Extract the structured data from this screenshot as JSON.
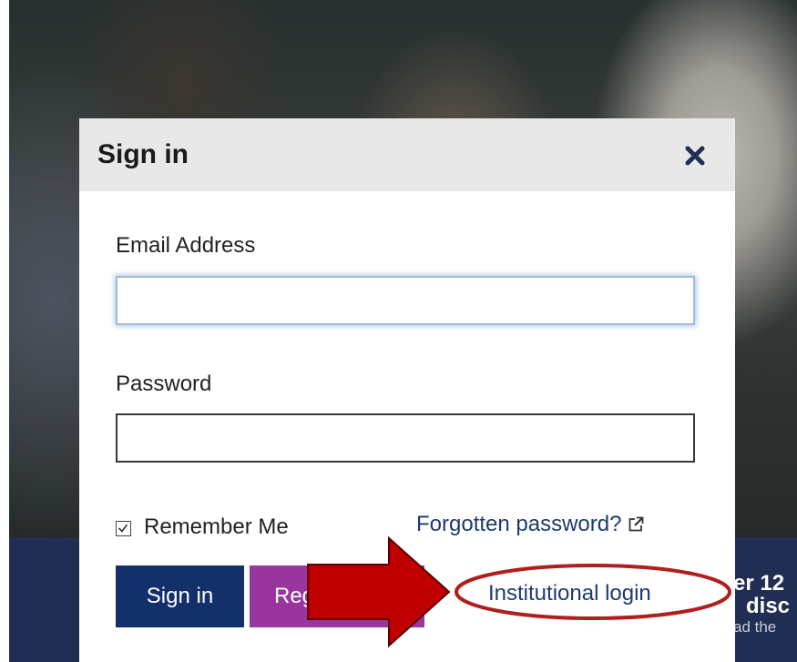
{
  "background": {
    "teaser_line1": "er 12",
    "teaser_line2": "disc",
    "teaser_line3": "ad the"
  },
  "modal": {
    "title": "Sign in",
    "close_icon": "close-icon",
    "email": {
      "label": "Email Address",
      "value": "",
      "placeholder": ""
    },
    "password": {
      "label": "Password",
      "value": "",
      "placeholder": ""
    },
    "remember_me": {
      "label": "Remember Me",
      "checked": true
    },
    "forgot_password": {
      "label": "Forgotten password?",
      "icon": "external-link-icon"
    },
    "buttons": {
      "sign_in": "Sign in",
      "register": "Register"
    },
    "institutional_login": "Institutional login"
  },
  "annotation": {
    "arrow_color": "#c00000",
    "ellipse_color": "#b01e1e"
  },
  "colors": {
    "primary_navy": "#14306b",
    "register_purple": "#9a359f",
    "link_blue": "#1f3a6e",
    "header_gray": "#e8e8e8"
  }
}
